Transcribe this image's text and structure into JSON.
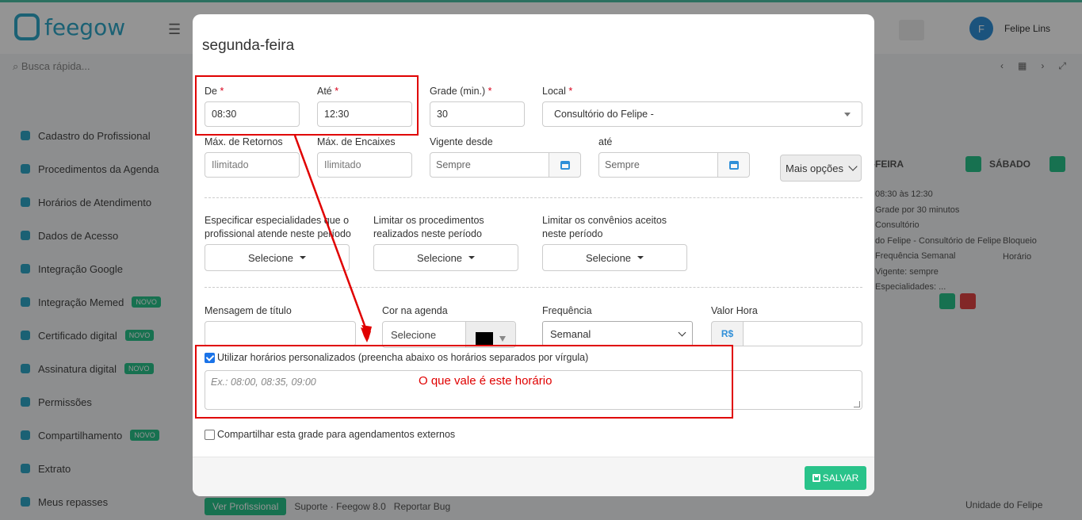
{
  "background": {
    "brand": "feegow",
    "search_placeholder": "Busca rápida...",
    "user_initial": "F",
    "user_name": "Felipe Lins",
    "sidebar": [
      {
        "label": "Cadastro do Profissional",
        "badge": ""
      },
      {
        "label": "Procedimentos da Agenda",
        "badge": ""
      },
      {
        "label": "Horários de Atendimento",
        "badge": ""
      },
      {
        "label": "Dados de Acesso",
        "badge": ""
      },
      {
        "label": "Integração Google",
        "badge": ""
      },
      {
        "label": "Integração Memed",
        "badge": "NOVO"
      },
      {
        "label": "Certificado digital",
        "badge": "NOVO"
      },
      {
        "label": "Assinatura digital",
        "badge": "NOVO"
      },
      {
        "label": "Permissões",
        "badge": ""
      },
      {
        "label": "Compartilhamento",
        "badge": "NOVO"
      },
      {
        "label": "Extrato",
        "badge": ""
      },
      {
        "label": "Meus repasses",
        "badge": ""
      }
    ],
    "right_panel": {
      "col1": "-FEIRA",
      "col2": "SÁBADO",
      "lines": [
        "08:30 às 12:30",
        "Grade por 30 minutos",
        "Consultório",
        "do Felipe - Consultório de Felipe",
        "Frequência Semanal",
        "Vigente: sempre",
        "Especialidades: ..."
      ],
      "lines2": [
        "Bloqueio",
        "Horário"
      ]
    },
    "bottom_bar": {
      "pill": "Ver Profissional",
      "item1": "Suporte · Feegow 8.0",
      "item2": "Reportar Bug"
    },
    "footer_right": "Unidade do Felipe"
  },
  "modal": {
    "title": "segunda-feira",
    "required_mark": "*",
    "de": {
      "label": "De",
      "value": "08:30"
    },
    "ate": {
      "label": "Até",
      "value": "12:30"
    },
    "grade": {
      "label": "Grade (min.)",
      "value": "30"
    },
    "local": {
      "label": "Local",
      "value": "Consultório do Felipe -"
    },
    "max_retornos": {
      "label": "Máx. de Retornos",
      "placeholder": "Ilimitado"
    },
    "max_encaixes": {
      "label": "Máx. de Encaixes",
      "placeholder": "Ilimitado"
    },
    "vigente_desde": {
      "label": "Vigente desde",
      "placeholder": "Sempre"
    },
    "vigente_ate": {
      "label": "até",
      "placeholder": "Sempre"
    },
    "mais_opcoes": "Mais opções",
    "especialidades": {
      "label": "Especificar especialidades que o profissional atende neste período",
      "button": "Selecione"
    },
    "procedimentos": {
      "label": "Limitar os procedimentos realizados neste período",
      "button": "Selecione"
    },
    "convenios": {
      "label": "Limitar os convênios aceitos neste período",
      "button": "Selecione"
    },
    "mensagem": {
      "label": "Mensagem de título",
      "value": ""
    },
    "cor": {
      "label": "Cor na agenda",
      "value": "Selecione",
      "swatch_color": "#000000"
    },
    "frequencia": {
      "label": "Frequência",
      "value": "Semanal"
    },
    "valor_hora": {
      "label": "Valor Hora",
      "prefix": "R$",
      "value": ""
    },
    "custom_hours": {
      "checked": true,
      "label": "Utilizar horários personalizados (preencha abaixo os horários separados por vírgula)",
      "placeholder": "Ex.: 08:00, 08:35, 09:00"
    },
    "share": {
      "checked": false,
      "label": "Compartilhar esta grade para agendamentos externos"
    },
    "save_label": "SALVAR"
  },
  "annotation": {
    "text": "O que vale é este horário",
    "color": "#e00000"
  }
}
